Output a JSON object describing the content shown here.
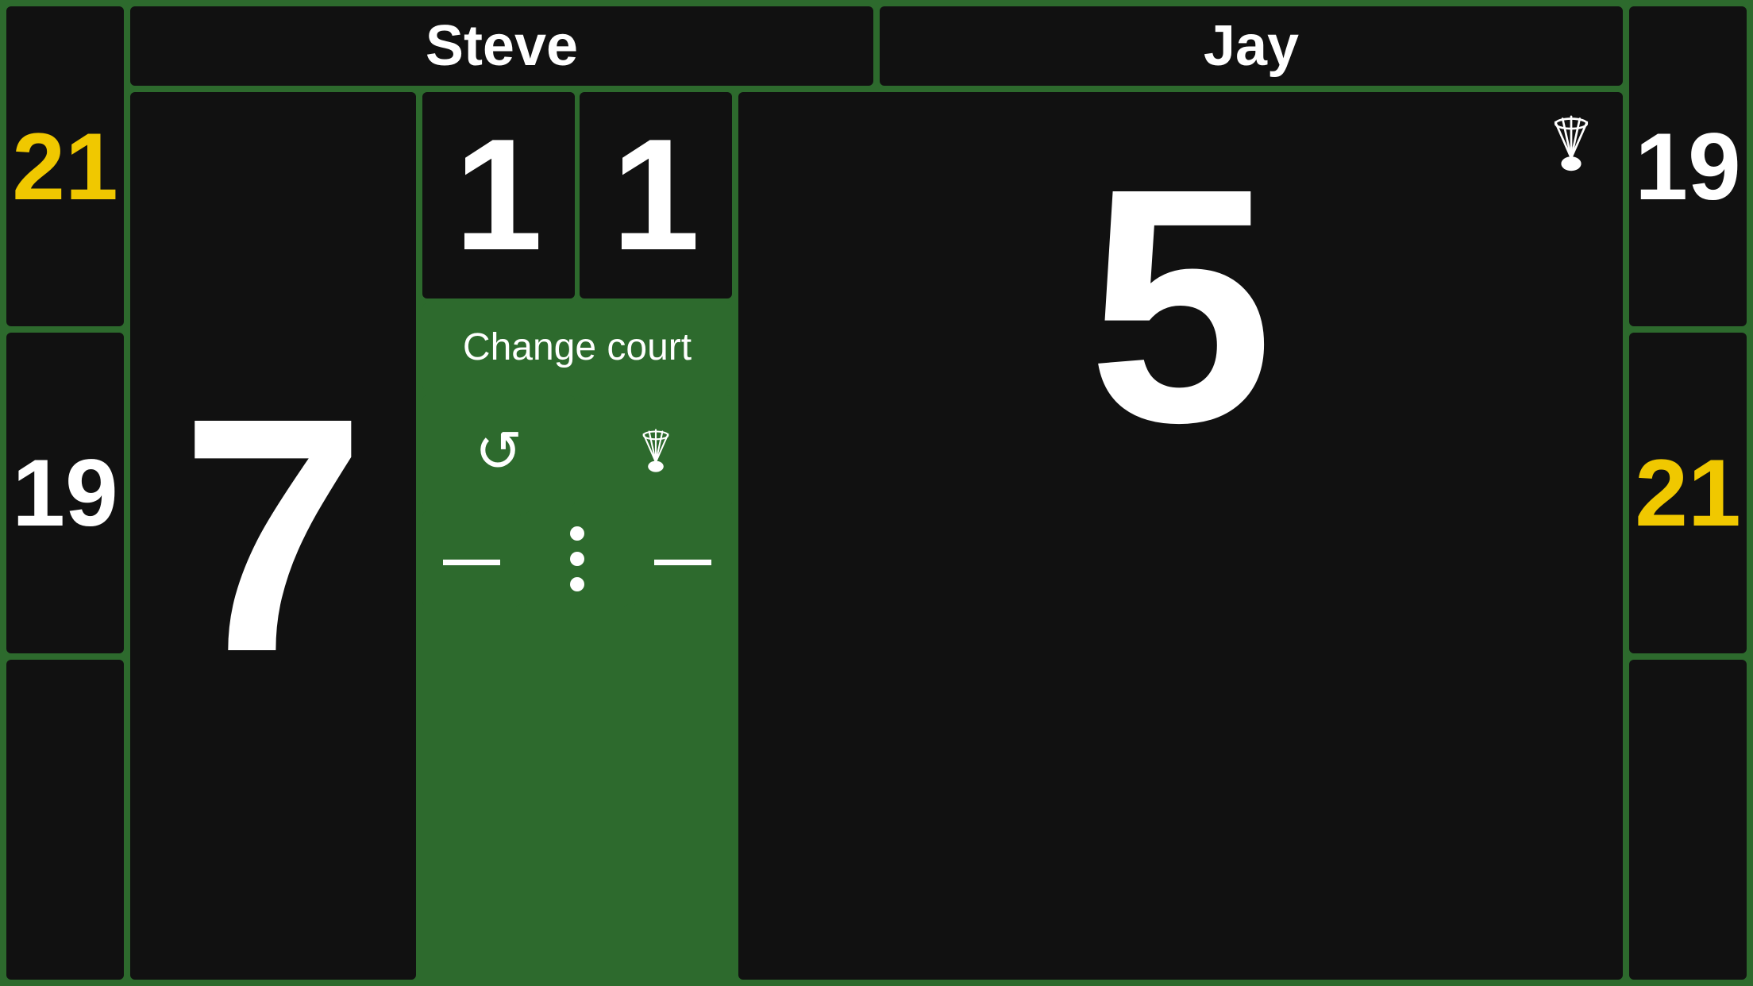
{
  "players": {
    "left": {
      "name": "Steve",
      "current_score": "7",
      "set_scores": [
        "21",
        "19"
      ]
    },
    "right": {
      "name": "Jay",
      "current_score": "5",
      "set_scores": [
        "19",
        "21"
      ],
      "has_serve": true
    }
  },
  "sets": {
    "left": "1",
    "right": "1"
  },
  "controls": {
    "change_court": "Change court",
    "undo_icon": "↺",
    "shuttlecock_icon": "🏸",
    "minus_left": "—",
    "dots": "⋮",
    "minus_right": "—"
  },
  "colors": {
    "background": "#2d6a2d",
    "cell_bg": "#111111",
    "yellow": "#f0c800",
    "white": "#ffffff",
    "green_btn": "#2d6a2d"
  }
}
